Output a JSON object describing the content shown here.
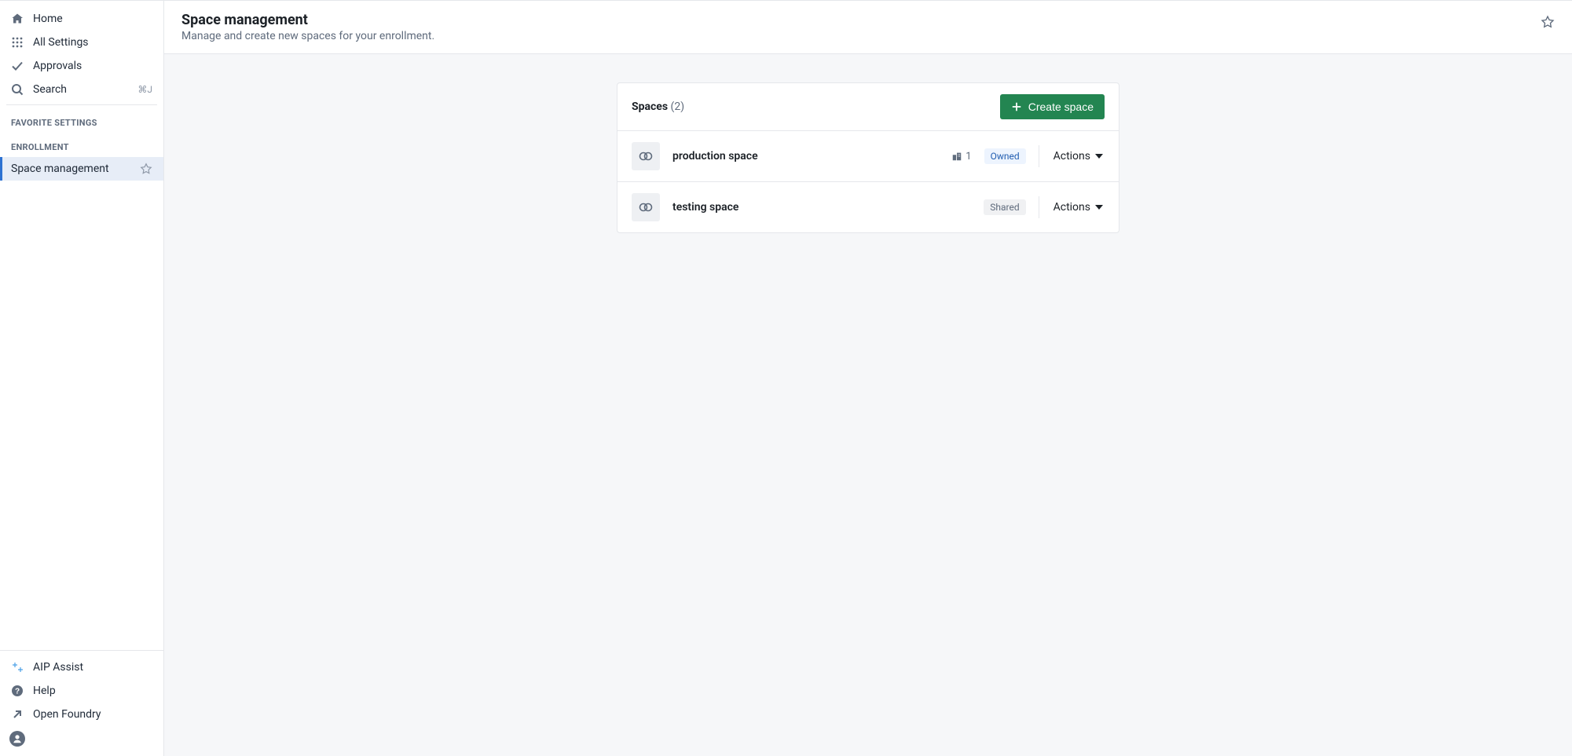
{
  "sidebar": {
    "nav": [
      {
        "label": "Home"
      },
      {
        "label": "All Settings"
      },
      {
        "label": "Approvals"
      },
      {
        "label": "Search",
        "shortcut": "⌘J"
      }
    ],
    "sections": {
      "favorite_label": "FAVORITE SETTINGS",
      "enrollment_label": "ENROLLMENT",
      "enrollment_items": [
        {
          "label": "Space management"
        }
      ]
    },
    "footer": [
      {
        "label": "AIP Assist"
      },
      {
        "label": "Help"
      },
      {
        "label": "Open Foundry"
      }
    ]
  },
  "header": {
    "title": "Space management",
    "subtitle": "Manage and create new spaces for your enrollment."
  },
  "spaces": {
    "title": "Spaces",
    "count_display": "(2)",
    "create_label": "Create space",
    "actions_label": "Actions",
    "rows": [
      {
        "name": "production space",
        "chip_count": "1",
        "badge": "Owned",
        "badge_kind": "owned",
        "has_chip": true
      },
      {
        "name": "testing space",
        "badge": "Shared",
        "badge_kind": "shared",
        "has_chip": false
      }
    ]
  }
}
